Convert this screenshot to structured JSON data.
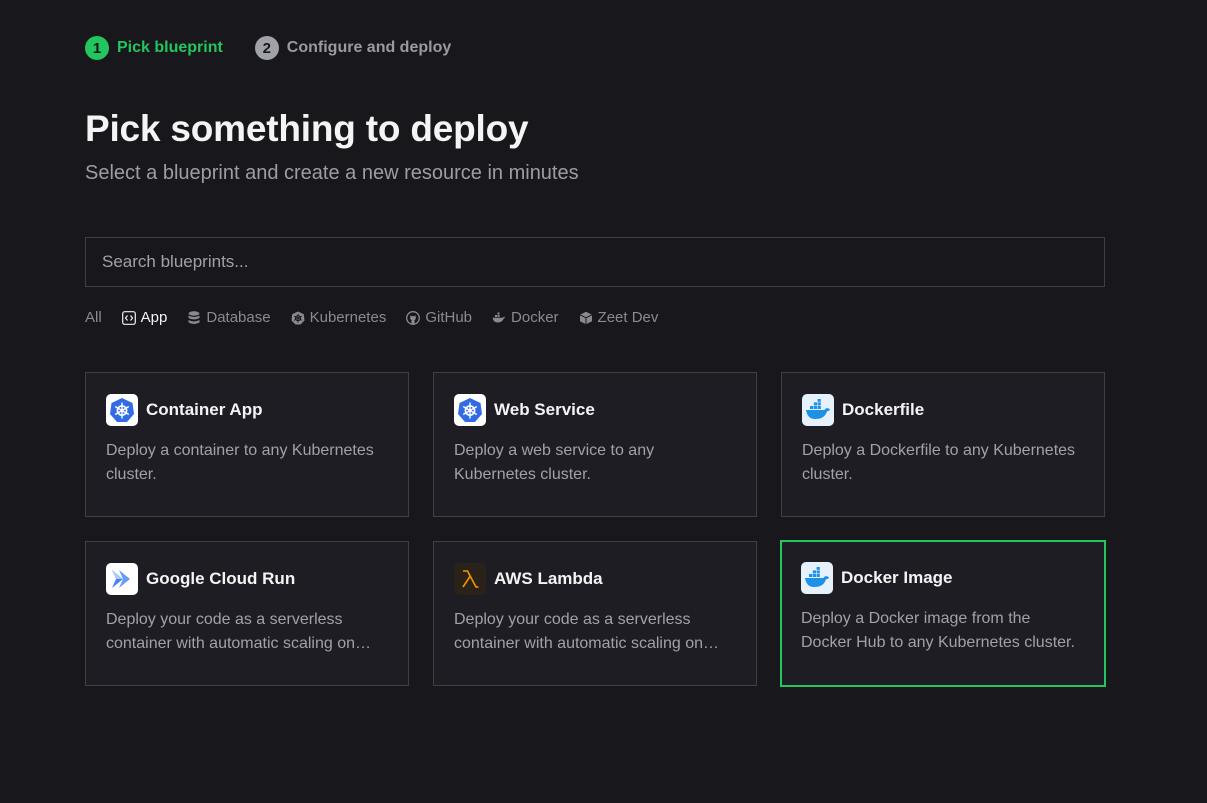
{
  "stepper": {
    "steps": [
      {
        "number": "1",
        "label": "Pick blueprint",
        "state": "active"
      },
      {
        "number": "2",
        "label": "Configure and deploy",
        "state": "inactive"
      }
    ]
  },
  "header": {
    "title": "Pick something to deploy",
    "subtitle": "Select a blueprint and create a new resource in minutes"
  },
  "search": {
    "placeholder": "Search blueprints...",
    "value": ""
  },
  "filters": [
    {
      "label": "All",
      "icon": "",
      "active": false
    },
    {
      "label": "App",
      "icon": "code-icon",
      "active": true
    },
    {
      "label": "Database",
      "icon": "database-icon",
      "active": false
    },
    {
      "label": "Kubernetes",
      "icon": "kubernetes-icon",
      "active": false
    },
    {
      "label": "GitHub",
      "icon": "github-icon",
      "active": false
    },
    {
      "label": "Docker",
      "icon": "docker-icon",
      "active": false
    },
    {
      "label": "Zeet Dev",
      "icon": "cube-icon",
      "active": false
    }
  ],
  "cards": [
    {
      "title": "Container App",
      "description": "Deploy a container to any Kubernetes cluster.",
      "icon": "kubernetes-icon",
      "selected": false
    },
    {
      "title": "Web Service",
      "description": "Deploy a web service to any Kubernetes cluster.",
      "icon": "kubernetes-icon",
      "selected": false
    },
    {
      "title": "Dockerfile",
      "description": "Deploy a Dockerfile to any Kubernetes cluster.",
      "icon": "docker-icon",
      "selected": false
    },
    {
      "title": "Google Cloud Run",
      "description": "Deploy your code as a serverless container with automatic scaling on demand.",
      "icon": "cloud-run-icon",
      "selected": false
    },
    {
      "title": "AWS Lambda",
      "description": "Deploy your code as a serverless container with automatic scaling on demand.",
      "icon": "lambda-icon",
      "selected": false
    },
    {
      "title": "Docker Image",
      "description": "Deploy a Docker image from the Docker Hub to any Kubernetes cluster.",
      "icon": "docker-icon",
      "selected": true
    }
  ],
  "colors": {
    "accent": "#22c55e",
    "background": "#18171c",
    "card_background": "#1e1d24",
    "border": "#3f3f46",
    "kubernetes_blue": "#326ce5",
    "docker_blue": "#1d91e6",
    "lambda_orange": "#f79400"
  }
}
